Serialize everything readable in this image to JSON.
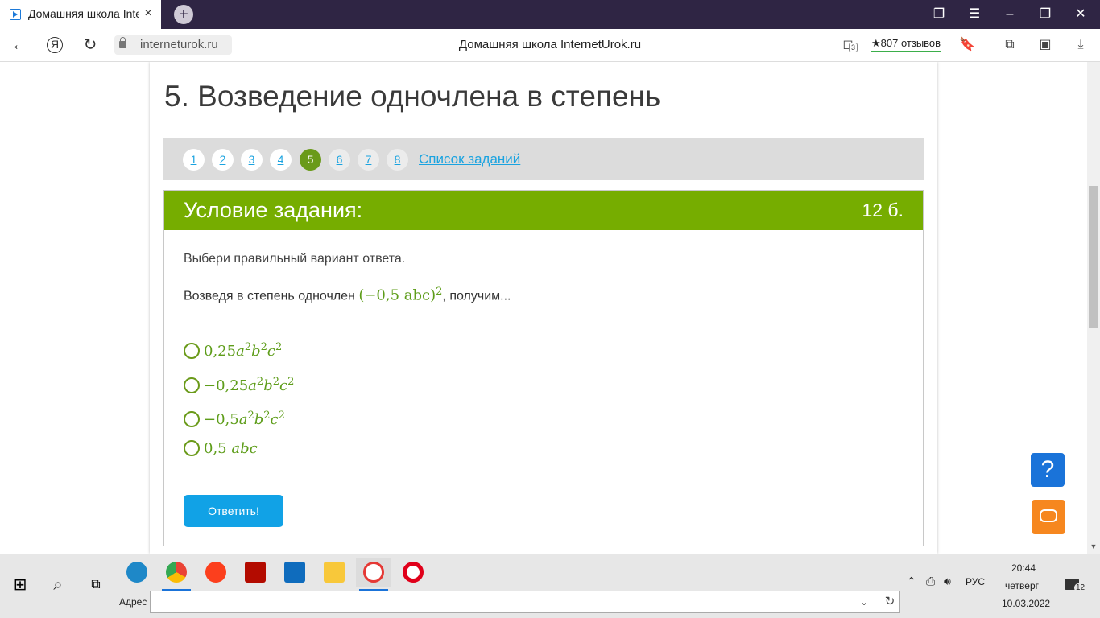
{
  "browser": {
    "tab_title": "Домашняя школа InternetUrok",
    "new_tab_symbol": "+",
    "url": "interneturok.ru",
    "page_heading": "Домашняя школа InternetUrok.ru",
    "reviews": "★807 отзывов",
    "protect_count": "3"
  },
  "lesson": {
    "title": "5. Возведение одночлена в степень",
    "task_numbers": [
      "1",
      "2",
      "3",
      "4",
      "5",
      "6",
      "7",
      "8"
    ],
    "active_task": "5",
    "task_list_link": "Список заданий"
  },
  "task": {
    "header": "Условие задания:",
    "points": "12 б.",
    "instruction": "Выбери правильный вариант ответа.",
    "question_prefix": "Возведя в степень одночлен ",
    "question_math": "(−0,5 abc)",
    "question_power": "2",
    "question_suffix": ", получим...",
    "options": [
      {
        "coef": "0,25",
        "a": "a",
        "ap": "2",
        "b": "b",
        "bp": "2",
        "c": "c",
        "cp": "2"
      },
      {
        "coef": "−0,25",
        "a": "a",
        "ap": "2",
        "b": "b",
        "bp": "2",
        "c": "c",
        "cp": "2"
      },
      {
        "coef": "−0,5",
        "a": "a",
        "ap": "2",
        "b": "b",
        "bp": "2",
        "c": "c",
        "cp": "2"
      },
      {
        "coef": "0,5 ",
        "a": "abc",
        "ap": "",
        "b": "",
        "bp": "",
        "c": "",
        "cp": ""
      }
    ],
    "submit_label": "Ответить!"
  },
  "side_buttons": {
    "help_label": "?"
  },
  "taskbar": {
    "address_label": "Адрес",
    "language": "РУС",
    "time": "20:44",
    "day": "четверг",
    "date": "10.03.2022",
    "notification_count": "12"
  },
  "colors": {
    "titlebar": "#2f2544",
    "task_header": "#76ad00",
    "active_page": "#6a9a19",
    "link": "#1aa3e0",
    "submit": "#11a2e6",
    "help": "#1a73d9",
    "chat": "#f6871f"
  },
  "icons": [
    "favicon-icon",
    "close-icon",
    "back-icon",
    "yandex-icon",
    "reload-icon",
    "lock-icon",
    "protect-icon",
    "bookmark-icon",
    "collections-icon",
    "screenshot-icon",
    "download-icon",
    "windows-start-icon",
    "search-icon",
    "task-view-icon",
    "chat-icon"
  ]
}
